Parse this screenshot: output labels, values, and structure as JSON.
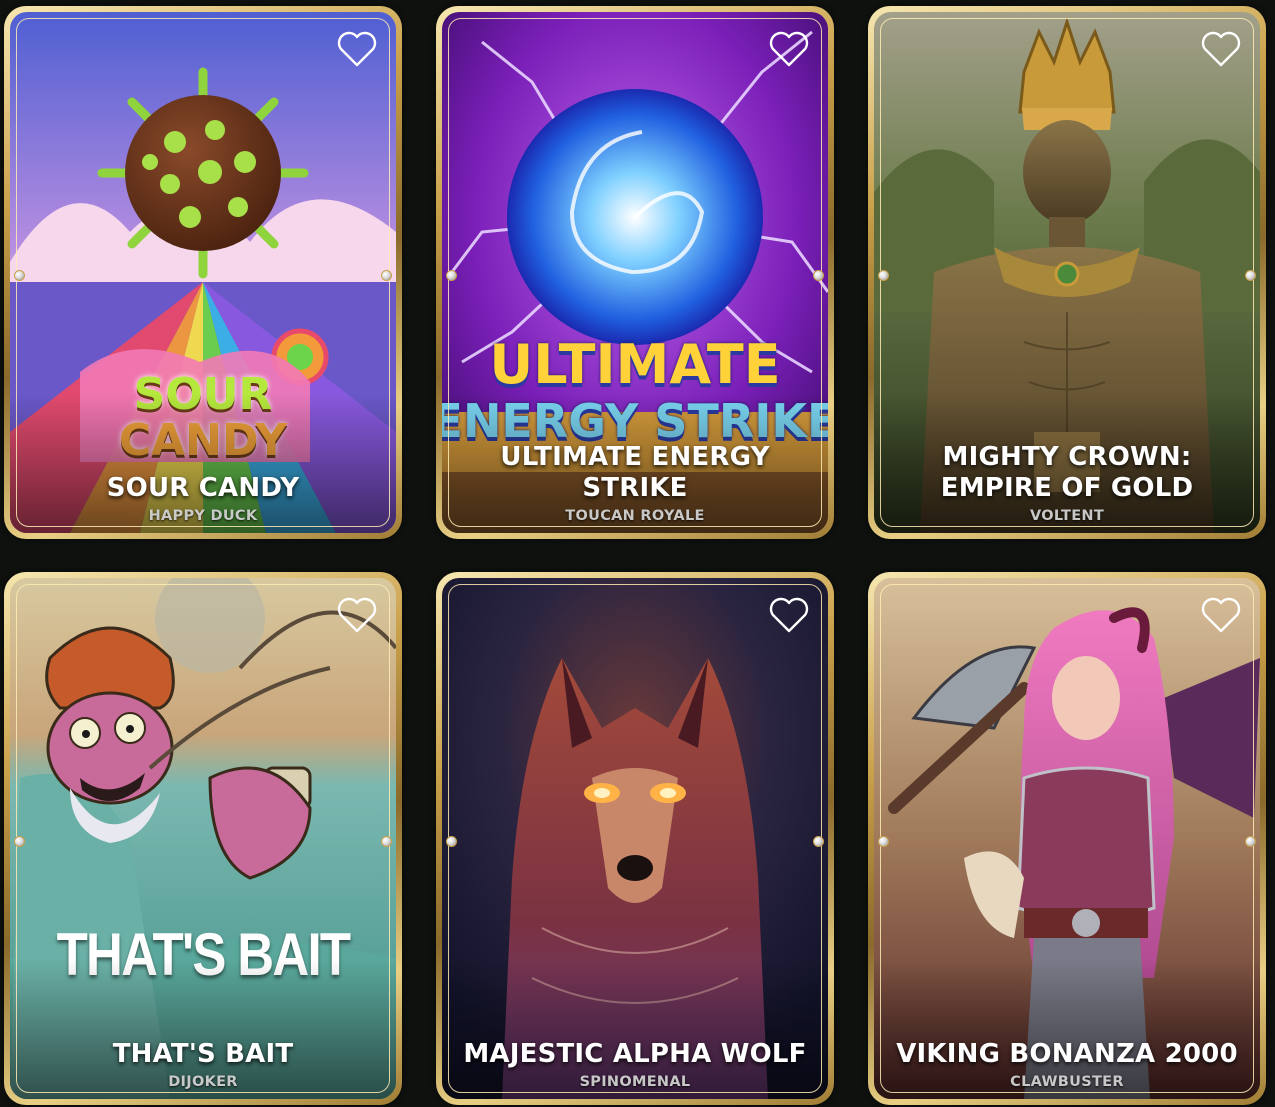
{
  "games": [
    {
      "title": "SOUR CANDY",
      "provider": "HAPPY DUCK",
      "logo_lines": [
        "SOUR",
        "CANDY"
      ],
      "art": "sour-candy-art",
      "colors": {
        "sky_top": "#5a6fd6",
        "sky_bottom": "#e8a9d9",
        "accent": "#8fd43c"
      }
    },
    {
      "title": "ULTIMATE ENERGY STRIKE",
      "provider": "TOUCAN ROYALE",
      "logo_lines": [
        "ULTIMATE",
        "ENERGY STRIKE"
      ],
      "art": "ultimate-energy-strike-art",
      "colors": {
        "bg": "#7a1fb8",
        "orb": "#3aa8ff",
        "accent": "#ffd23a"
      }
    },
    {
      "title": "MIGHTY CROWN: EMPIRE OF GOLD",
      "provider": "VOLTENT",
      "art": "mighty-crown-art",
      "colors": {
        "bg": "#4d5a2c",
        "figure": "#6b5634",
        "accent": "#c99a3a"
      }
    },
    {
      "title": "THAT'S BAIT",
      "provider": "DIJOKER",
      "logo_lines": [
        "THAT'S BAIT"
      ],
      "art": "thats-bait-art",
      "colors": {
        "bg": "#c9b27a",
        "water": "#4fa59a",
        "accent": "#c55a2a"
      }
    },
    {
      "title": "MAJESTIC ALPHA WOLF",
      "provider": "SPINOMENAL",
      "art": "majestic-alpha-wolf-art",
      "colors": {
        "bg": "#1d1f3a",
        "wolf": "#8a3a2e",
        "accent": "#ffb347"
      }
    },
    {
      "title": "VIKING BONANZA 2000",
      "provider": "CLAWBUSTER",
      "art": "viking-bonanza-art",
      "colors": {
        "bg": "#8a6a4a",
        "hair": "#e26fb4",
        "accent": "#8a3a5a"
      }
    }
  ],
  "icons": {
    "favorite": "heart-outline-icon"
  }
}
